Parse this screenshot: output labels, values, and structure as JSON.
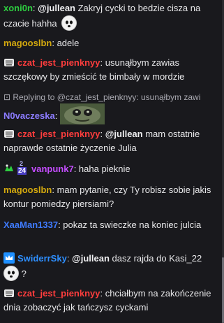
{
  "colors": {
    "xoni0n": "#2ecc40",
    "magooslbn": "#d4a90e",
    "czat_jest_pienknyy": "#ff3d3d",
    "N0vaczeska": "#8c7cff",
    "vanpunk7": "#c44dff",
    "XaaMan1337": "#3f7bff",
    "SwiderrSky": "#2e8fff"
  },
  "messages": [
    {
      "user": "xoni0n",
      "mention": "@jullean",
      "text": " Zakryj cycki to bedzie cisza na czacie hahha",
      "emote": "ghost-face-emote"
    },
    {
      "user": "magooslbn",
      "text": "adele"
    },
    {
      "user": "czat_jest_pienknyy",
      "badge": "gift-badge-icon",
      "text": "usunąłbym zawias szczękowy by zmieścić te bimbały w mordzie"
    },
    {
      "reply": "Replying to @czat_jest_pienknyy: usunąłbym zawi",
      "user": "N0vaczeska",
      "emote": "creature-emote"
    },
    {
      "user": "czat_jest_pienknyy",
      "badge": "gift-badge-icon",
      "mention": "@jullean",
      "text": " mam ostatnie naprawde ostatnie życzenie Julia"
    },
    {
      "user": "vanpunk7",
      "badge_a": "green-hand-badge",
      "badge_b": "24-month-badge",
      "badge_b_top": "2",
      "badge_b_bottom": "24",
      "text": "haha pieknie"
    },
    {
      "user": "magooslbn",
      "text": "mam pytanie, czy Ty robisz sobie jakis kontur pomiedzy piersiami?"
    },
    {
      "user": "XaaMan1337",
      "text": "pokaz ta swieczke na koniec julcia"
    },
    {
      "user": "SwiderrSky",
      "badge": "crown-badge-icon",
      "mention": "@jullean",
      "text": " dasz rajda do Kasi_22",
      "tail": "?"
    },
    {
      "user": "czat_jest_pienknyy",
      "badge": "gift-badge-icon",
      "text": "chciałbym na zakończenie dnia zobaczyć jak tańczysz cyckami"
    }
  ]
}
